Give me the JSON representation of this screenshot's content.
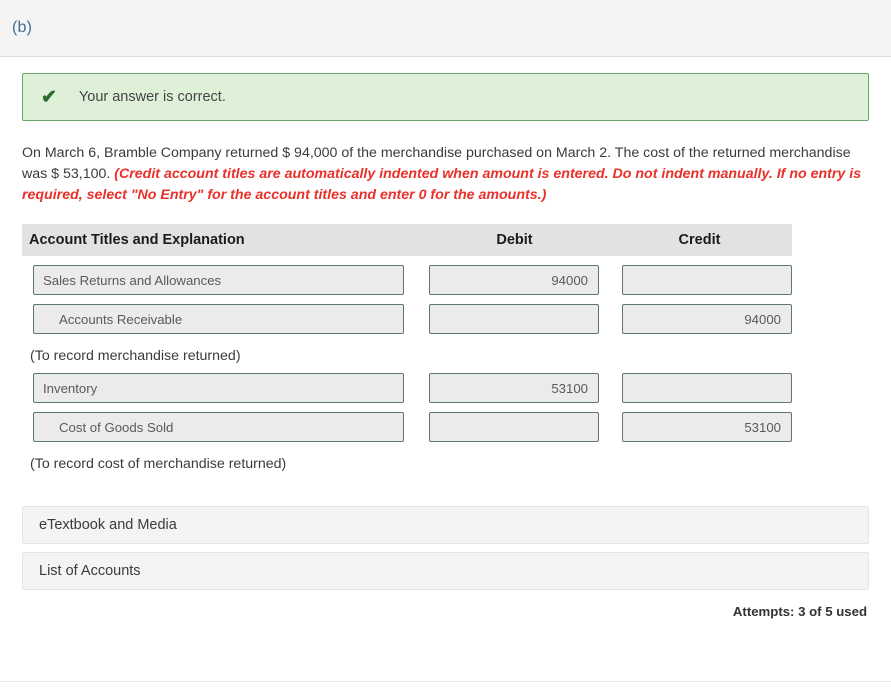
{
  "part": {
    "label": "(b)"
  },
  "banner": {
    "icon": "check-icon",
    "text": "Your answer is correct.",
    "bg_color": "#dff0d8",
    "border_color": "#6aa66a",
    "icon_color": "#2e6b2e"
  },
  "narrative": {
    "plain": "On March 6, Bramble Company returned $ 94,000 of the merchandise purchased on March 2. The cost of the returned merchandise was $ 53,100. ",
    "hint": "(Credit account titles are automatically indented when amount is entered. Do not indent manually. If no entry is required, select \"No Entry\" for the account titles and enter 0 for the amounts.)",
    "hint_color": "#e8312a"
  },
  "journal": {
    "headers": {
      "account": "Account Titles and Explanation",
      "debit": "Debit",
      "credit": "Credit"
    },
    "rows": [
      {
        "account": "Sales Returns and Allowances",
        "indented": false,
        "debit": "94000",
        "credit": ""
      },
      {
        "account": "Accounts Receivable",
        "indented": true,
        "debit": "",
        "credit": "94000"
      }
    ],
    "memo1": "(To record merchandise returned)",
    "rows2": [
      {
        "account": "Inventory",
        "indented": false,
        "debit": "53100",
        "credit": ""
      },
      {
        "account": "Cost of Goods Sold",
        "indented": true,
        "debit": "",
        "credit": "53100"
      }
    ],
    "memo2": "(To record cost of merchandise returned)"
  },
  "actions": {
    "etextbook": "eTextbook and Media",
    "list_of_accounts": "List of Accounts"
  },
  "attempts": {
    "text": "Attempts: 3 of 5 used"
  }
}
